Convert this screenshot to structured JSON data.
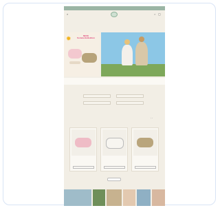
{
  "promo": {
    "text": ""
  },
  "header": {
    "logo_text": ""
  },
  "nav": {
    "items": [
      "",
      "",
      "",
      "",
      "",
      "",
      "",
      "",
      ""
    ]
  },
  "hero": {
    "headline_line1": "NEUE",
    "headline_line2": "Sommerkollektion",
    "product_tag": ""
  },
  "badges": {
    "items": [
      "",
      "",
      "",
      ""
    ]
  },
  "categories": {
    "chips": [
      "",
      "",
      "",
      ""
    ]
  },
  "products": [
    {
      "name": "",
      "price": "",
      "button": ""
    },
    {
      "name": "",
      "price": "",
      "button": ""
    },
    {
      "name": "",
      "price": "",
      "button": ""
    }
  ],
  "more_button": "",
  "colors": {
    "background": "#f2eee5",
    "accent": "#9bb5a5",
    "headline": "#e0457a",
    "sun": "#f3b31b"
  },
  "icons": [
    "search-icon",
    "account-icon",
    "cart-icon",
    "sun-icon",
    "arrow-left-icon",
    "arrow-right-icon"
  ]
}
